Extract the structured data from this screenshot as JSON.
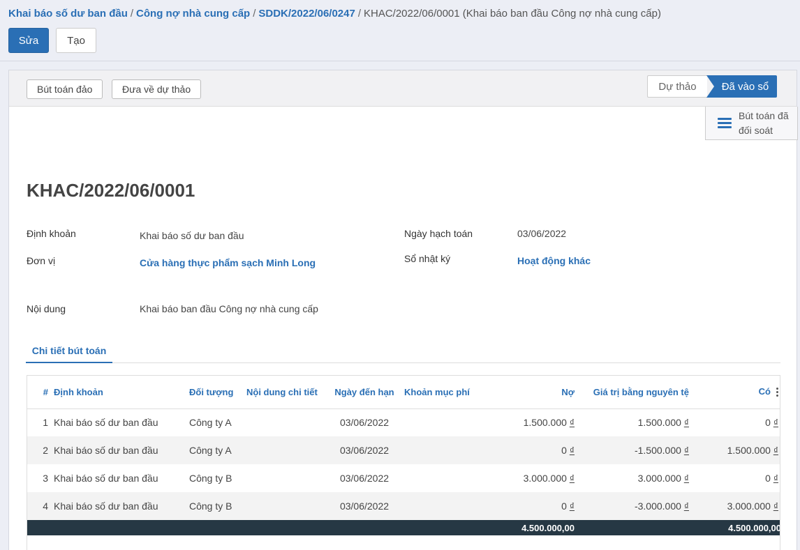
{
  "breadcrumb": {
    "items": [
      "Khai báo số dư ban đầu",
      "Công nợ nhà cung cấp",
      "SDDK/2022/06/0247"
    ],
    "current": "KHAC/2022/06/0001 (Khai báo ban đầu Công nợ nhà cung cấp)",
    "separator": "/"
  },
  "toolbar": {
    "edit_label": "Sửa",
    "create_label": "Tạo"
  },
  "statusbar": {
    "reverse_label": "Bút toán đảo",
    "draft_label": "Đưa về dự thảo",
    "stages": {
      "draft": "Dự thảo",
      "posted": "Đã vào sổ"
    }
  },
  "smart_button": {
    "line1": "Bút toán đã",
    "line2": "đối soát"
  },
  "record": {
    "title": "KHAC/2022/06/0001",
    "fields": {
      "account_label": "Định khoản",
      "account_value": "Khai báo số dư ban đầu",
      "unit_label": "Đơn vị",
      "unit_value": "Cửa hàng thực phẩm sạch Minh Long",
      "date_label": "Ngày hạch toán",
      "date_value": "03/06/2022",
      "journal_label": "Sổ nhật ký",
      "journal_value": "Hoạt động khác",
      "content_label": "Nội dung",
      "content_value": "Khai báo ban đầu Công nợ nhà cung cấp"
    }
  },
  "tabs": {
    "detail": "Chi tiết bút toán"
  },
  "table": {
    "headers": {
      "index": "#",
      "account": "Định khoản",
      "partner": "Đối tượng",
      "detail": "Nội dung chi tiết",
      "due": "Ngày đến hạn",
      "expense": "Khoản mục phí",
      "debit": "Nợ",
      "currency": "Giá trị bằng nguyên tệ",
      "credit": "Có"
    },
    "currency_symbol": "₫",
    "rows": [
      {
        "idx": "1",
        "account": "Khai báo số dư ban đầu",
        "partner": "Công ty A",
        "due": "03/06/2022",
        "debit": "1.500.000",
        "currency": "1.500.000",
        "credit": "0"
      },
      {
        "idx": "2",
        "account": "Khai báo số dư ban đầu",
        "partner": "Công ty A",
        "due": "03/06/2022",
        "debit": "0",
        "currency": "-1.500.000",
        "credit": "1.500.000"
      },
      {
        "idx": "3",
        "account": "Khai báo số dư ban đầu",
        "partner": "Công ty B",
        "due": "03/06/2022",
        "debit": "3.000.000",
        "currency": "3.000.000",
        "credit": "0"
      },
      {
        "idx": "4",
        "account": "Khai báo số dư ban đầu",
        "partner": "Công ty B",
        "due": "03/06/2022",
        "debit": "0",
        "currency": "-3.000.000",
        "credit": "3.000.000"
      }
    ],
    "totals": {
      "debit": "4.500.000,00",
      "credit": "4.500.000,00"
    }
  }
}
